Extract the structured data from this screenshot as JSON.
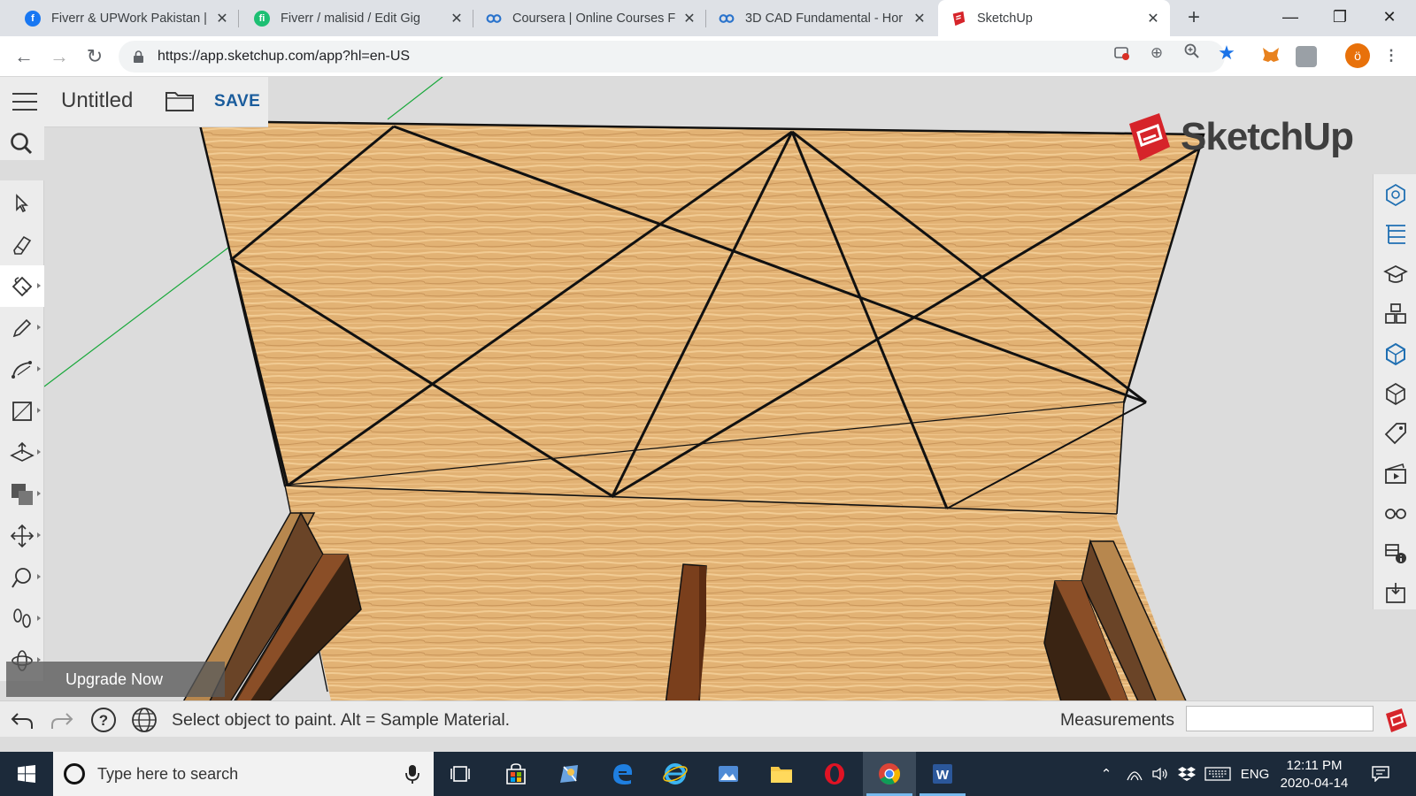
{
  "browser": {
    "tabs": [
      {
        "title": "Fiverr & UPWork Pakistan |",
        "icon": "facebook-icon",
        "color": "#1877f2"
      },
      {
        "title": "Fiverr / malisid / Edit Gig",
        "icon": "fiverr-icon",
        "color": "#1dbf73"
      },
      {
        "title": "Coursera | Online Courses F",
        "icon": "coursera-icon",
        "color": "#2a73cc"
      },
      {
        "title": "3D CAD Fundamental - Hor",
        "icon": "coursera-icon",
        "color": "#2a73cc"
      },
      {
        "title": "SketchUp",
        "icon": "sketchup-icon",
        "color": "#d6242a"
      }
    ],
    "url": "https://app.sketchup.com/app?hl=en-US",
    "new_tab": "+",
    "window_controls": {
      "minimize": "—",
      "restore": "❐",
      "close": "✕"
    }
  },
  "app": {
    "title": "Untitled",
    "save_label": "SAVE",
    "logo_text": "SketchUp",
    "upgrade_label": "Upgrade Now",
    "status_text": "Select object to paint. Alt = Sample Material.",
    "measurements_label": "Measurements",
    "measurements_value": "",
    "left_tools": [
      "select",
      "eraser",
      "paint-bucket",
      "pencil",
      "arc",
      "rectangle",
      "push-pull",
      "offset",
      "move",
      "tape-measure",
      "walk",
      "orbit"
    ],
    "selected_tool": "paint-bucket",
    "right_panels": [
      "entity-info",
      "outliner",
      "instructor",
      "components",
      "materials",
      "styles",
      "tags",
      "scenes",
      "display",
      "solid-inspector",
      "export"
    ],
    "colors": {
      "accent": "#1a5c9c",
      "wood": "#e2b274",
      "logo_red": "#d6242a"
    }
  },
  "taskbar": {
    "search_placeholder": "Type here to search",
    "language": "ENG",
    "time": "12:11 PM",
    "date": "2020-04-14",
    "apps": [
      "task-view",
      "store",
      "paint-3d",
      "edge",
      "internet-explorer",
      "photos",
      "file-explorer",
      "opera",
      "chrome",
      "word"
    ]
  }
}
